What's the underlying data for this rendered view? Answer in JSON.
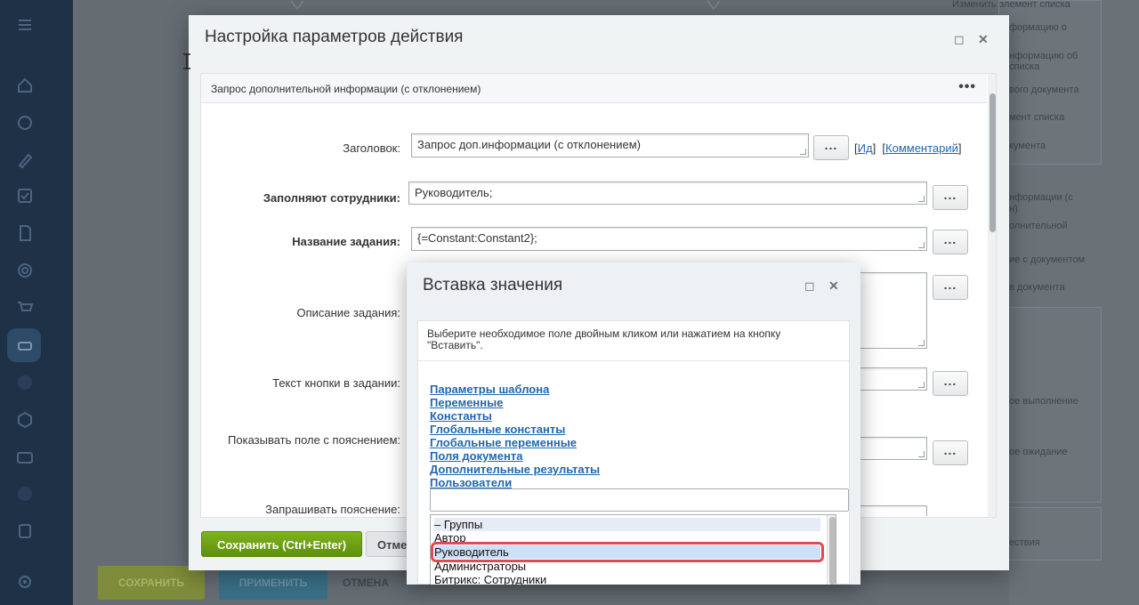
{
  "background": {
    "right_items": [
      "Изменить элемент списка",
      "формацию о",
      "нформацию об",
      "списка",
      "вого документа",
      "мент списка",
      "кумента",
      "нформации (с",
      "н)",
      "олнительной",
      "ие с документом",
      "в документа",
      "ое выполнение",
      "ое ожидание",
      "ествия"
    ],
    "buttons": {
      "save": "СОХРАНИТЬ",
      "apply": "ПРИМЕНИТЬ",
      "cancel": "ОТМЕНА"
    },
    "colors": {
      "rail": "#1f3147",
      "save_btn": "#7f8c3a",
      "apply_btn": "#3a6f86"
    }
  },
  "main_dialog": {
    "title": "Настройка параметров действия",
    "section_title": "Запрос дополнительной информации (с отклонением)",
    "fields": {
      "header_label": "Заголовок:",
      "header_value": "Запрос доп.информации (с отклонением)",
      "fill_label": "Заполняют сотрудники:",
      "fill_value": "Руководитель;",
      "task_name_label": "Название задания:",
      "task_name_value": "{=Constant:Constant2};",
      "task_desc_label": "Описание задания:",
      "button_text_label": "Текст кнопки в задании:",
      "show_field_label": "Показывать поле с пояснением:",
      "ask_label": "Запрашивать пояснение:"
    },
    "links": {
      "id": "Ид",
      "comment": "Комментарий"
    },
    "dots_label": "...",
    "footer": {
      "save": "Сохранить (Ctrl+Enter)",
      "cancel": "Отме"
    },
    "colors": {
      "save": "#6f9a12",
      "link": "#2067b0"
    }
  },
  "insert_dialog": {
    "title": "Вставка значения",
    "note": "Выберите необходимое поле двойным кликом или нажатием на кнопку \"Вставить\".",
    "categories": [
      "Параметры шаблона",
      "Переменные",
      "Константы",
      "Глобальные константы",
      "Глобальные переменные",
      "Поля документа",
      "Дополнительные результаты",
      "Пользователи"
    ],
    "search_value": "",
    "list_items": [
      "– Группы",
      "Автор",
      "Руководитель",
      "Администраторы",
      "Битрикс: Сотрудники"
    ],
    "selected_item": "Руководитель",
    "colors": {
      "highlight": "#e04a55",
      "selected": "#cde0f8"
    }
  }
}
